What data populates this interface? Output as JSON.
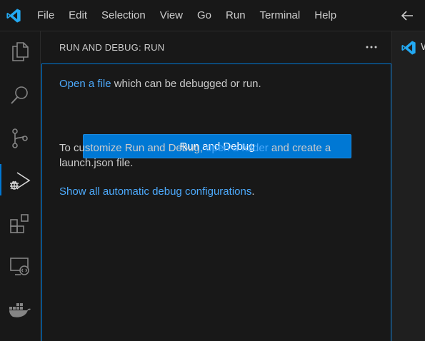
{
  "menu": {
    "items": [
      "File",
      "Edit",
      "Selection",
      "View",
      "Go",
      "Run",
      "Terminal",
      "Help"
    ]
  },
  "icons": {
    "app": "vscode-logo-icon",
    "back": "arrow-left-icon",
    "activity": [
      "files-explorer-icon",
      "search-icon",
      "source-control-icon",
      "run-debug-icon",
      "extensions-icon",
      "remote-explorer-icon",
      "docker-icon"
    ],
    "more": "more-actions-icon"
  },
  "colors": {
    "accent": "#0078d4",
    "link": "#4daafc",
    "logo": "#23a9f2"
  },
  "sidebar": {
    "title": "RUN AND DEBUG: RUN",
    "line1_link": "Open a file",
    "line1_rest": " which can be debugged or run.",
    "button_label": "Run and Debug",
    "line2_prefix": "To customize Run and Debug, ",
    "line2_link": "open a folder",
    "line2_suffix": " and create a",
    "line3": "launch.json file.",
    "line4_link": "Show all automatic debug configurations",
    "line4_suffix": "."
  },
  "editor": {
    "tab_label": "W"
  }
}
